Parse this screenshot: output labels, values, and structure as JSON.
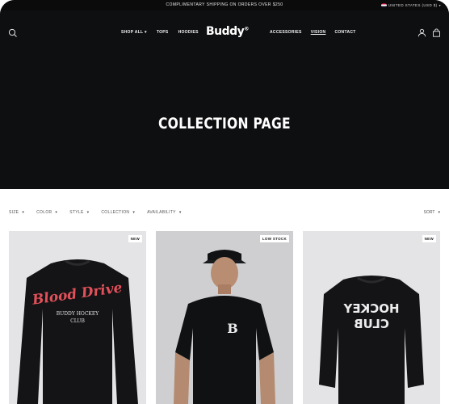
{
  "announcement": "COMPLIMENTARY SHIPPING ON ORDERS OVER $250",
  "locale": {
    "label": "UNITED STATES (USD $)"
  },
  "header": {
    "logo": "Buddy",
    "logo_mark": "®",
    "nav_left": [
      "SHOP ALL",
      "TOPS",
      "HOODIES"
    ],
    "nav_right": [
      "ACCESSORIES",
      "VISION",
      "CONTACT"
    ],
    "active_nav": "VISION",
    "icons": [
      "search-icon",
      "account-icon",
      "cart-icon"
    ]
  },
  "hero": {
    "title": "COLLECTION PAGE"
  },
  "filters": [
    "SIZE",
    "COLOR",
    "STYLE",
    "COLLECTION",
    "AVAILABILITY"
  ],
  "sort_label": "SORT",
  "products": [
    {
      "badge": "NEW",
      "graphic_text": "Blood Drive",
      "sub_text": "BUDDY HOCKEY",
      "sub_text2": "CLUB"
    },
    {
      "badge": "LOW STOCK",
      "graphic_text": "B"
    },
    {
      "badge": "NEW",
      "graphic_text": "HOCKEY",
      "sub_text": "CLUB"
    }
  ],
  "colors": {
    "hero_bg": "#0e0f11",
    "accent_red": "#e2505a",
    "card_bg": "#e4e4e6"
  }
}
